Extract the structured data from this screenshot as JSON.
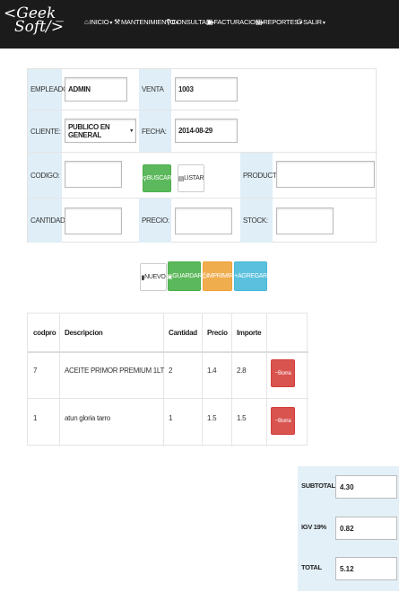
{
  "brand": {
    "line1": "<Geek_",
    "line2": "Soft/>"
  },
  "nav": [
    {
      "icon": "home-icon",
      "glyph": "⌂",
      "label": "INICIO"
    },
    {
      "icon": "wrench-icon",
      "glyph": "⚒",
      "label": "MANTENIMIENTO"
    },
    {
      "icon": "search-icon",
      "glyph": "⚲",
      "label": "CONSULTAS"
    },
    {
      "icon": "cart-icon",
      "glyph": "▣",
      "label": "FACTURACION"
    },
    {
      "icon": "reports-icon",
      "glyph": "▤",
      "label": "REPORTES"
    },
    {
      "icon": "power-icon",
      "glyph": "⏻",
      "label": "SALIR"
    }
  ],
  "form": {
    "empleado_label": "EMPLEADO:",
    "empleado_value": "ADMIN",
    "venta_label": "VENTA",
    "venta_value": "1003",
    "cliente_label": "CLIENTE:",
    "cliente_value": "PUBLICO EN GENERAL",
    "fecha_label": "FECHA:",
    "fecha_value": "2014-08-29",
    "codigo_label": "CODIGO:",
    "codigo_value": "",
    "buscar_label": "BUSCAR",
    "listar_label": "LISTAR",
    "producto_label": "PRODUCTO:",
    "producto_value": "",
    "cantidad_label": "CANTIDAD:",
    "cantidad_value": "",
    "precio_label": "PRECIO:",
    "precio_value": "",
    "stock_label": "STOCK:",
    "stock_value": ""
  },
  "actions": {
    "nuevo": "NUEVO",
    "guardar": "GUARDAR",
    "imprimir": "IMPRIMIR",
    "agregar": "AGREGAR"
  },
  "table": {
    "headers": [
      "codpro",
      "Descripcion",
      "Cantidad",
      "Precio",
      "Importe"
    ],
    "rows": [
      {
        "codpro": "7",
        "descripcion": "ACEITE PRIMOR PREMIUM 1LT",
        "cantidad": "2",
        "precio": "1.4",
        "importe": "2.8",
        "action": "Borra"
      },
      {
        "codpro": "1",
        "descripcion": "atun gloria tarro",
        "cantidad": "1",
        "precio": "1.5",
        "importe": "1.5",
        "action": "Borra"
      }
    ]
  },
  "totals": {
    "subtotal_label": "SUBTOTAL",
    "subtotal_value": "4.30",
    "igv_label": "IGV 19%",
    "igv_value": "0.82",
    "total_label": "TOTAL",
    "total_value": "5.12"
  },
  "colors": {
    "navbar": "#1b1b1b",
    "label_bg": "#dfeef7",
    "success": "#5cb85c",
    "warning": "#f0ad4e",
    "info": "#5bc0de",
    "danger": "#d9534f"
  }
}
